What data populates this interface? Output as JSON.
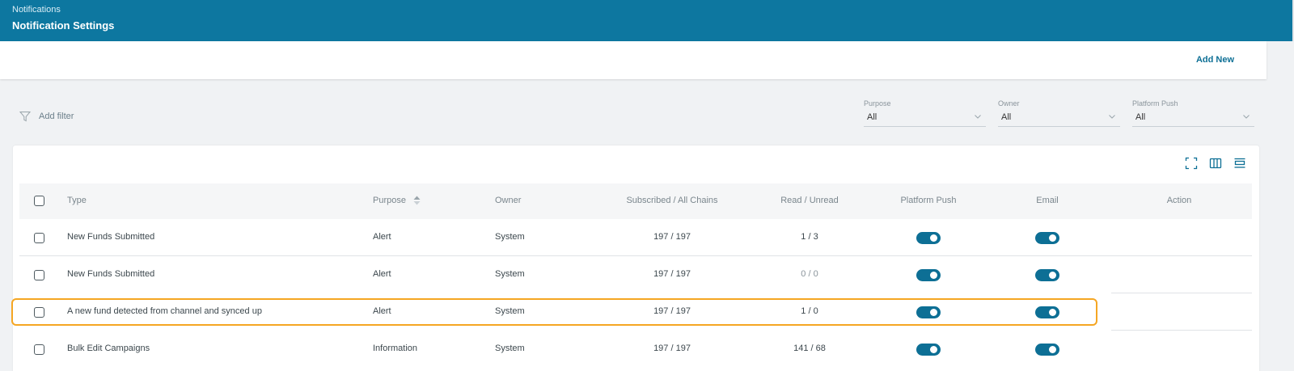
{
  "header": {
    "breadcrumb": "Notifications",
    "title": "Notification Settings"
  },
  "toolbar": {
    "add_new_label": "Add New"
  },
  "filters": {
    "add_filter_label": "Add filter",
    "purpose": {
      "label": "Purpose",
      "value": "All"
    },
    "owner": {
      "label": "Owner",
      "value": "All"
    },
    "platform_push": {
      "label": "Platform Push",
      "value": "All"
    }
  },
  "table": {
    "columns": {
      "type": "Type",
      "purpose": "Purpose",
      "owner": "Owner",
      "subscribed": "Subscribed / All Chains",
      "read_unread": "Read / Unread",
      "platform_push": "Platform Push",
      "email": "Email",
      "action": "Action"
    },
    "rows": [
      {
        "type": "New Funds Submitted",
        "purpose": "Alert",
        "owner": "System",
        "subscribed": "197 / 197",
        "read_unread": "1 / 3",
        "platform_push": true,
        "email": true
      },
      {
        "type": "New Funds Submitted",
        "purpose": "Alert",
        "owner": "System",
        "subscribed": "197 / 197",
        "read_unread": "0 / 0",
        "platform_push": true,
        "email": true
      },
      {
        "type": "A new fund detected from channel and synced up",
        "purpose": "Alert",
        "owner": "System",
        "subscribed": "197 / 197",
        "read_unread": "1 / 0",
        "platform_push": true,
        "email": true
      },
      {
        "type": "Bulk Edit Campaigns",
        "purpose": "Information",
        "owner": "System",
        "subscribed": "197 / 197",
        "read_unread": "141 / 68",
        "platform_push": true,
        "email": true
      }
    ]
  },
  "colors": {
    "header_bg": "#0d77a0",
    "accent": "#0d6f95",
    "highlight": "#f5a623"
  },
  "icons": [
    "filter-icon",
    "chevron-down-icon",
    "fullscreen-icon",
    "columns-icon",
    "density-icon",
    "sort-icon"
  ]
}
